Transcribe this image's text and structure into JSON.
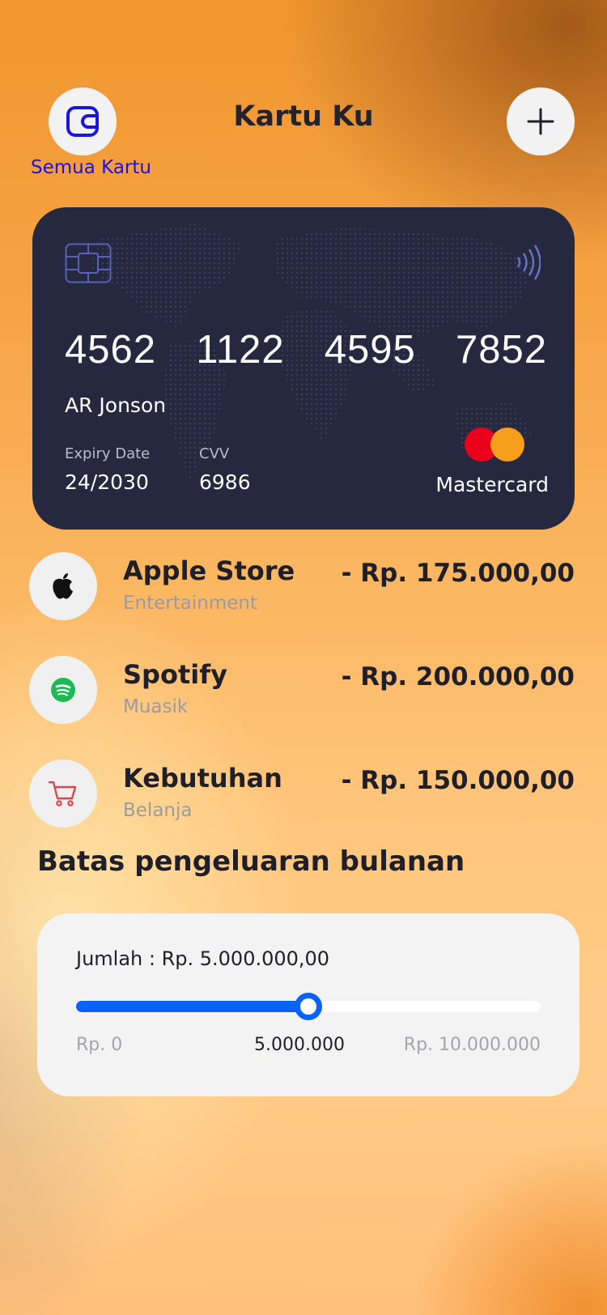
{
  "header": {
    "title": "Kartu Ku",
    "all_cards_label": "Semua Kartu",
    "wallet_icon": "wallet-icon",
    "add_icon": "plus-icon"
  },
  "card": {
    "number_groups": [
      "4562",
      "1122",
      "4595",
      "7852"
    ],
    "holder": "AR Jonson",
    "expiry_label": "Expiry Date",
    "expiry_value": "24/2030",
    "cvv_label": "CVV",
    "cvv_value": "6986",
    "brand": "Mastercard",
    "background_color": "#262840"
  },
  "transactions": [
    {
      "name": "Apple Store",
      "category": "Entertainment",
      "amount": "- Rp. 175.000,00",
      "icon": "apple-icon"
    },
    {
      "name": "Spotify",
      "category": "Muasik",
      "amount": "- Rp. 200.000,00",
      "icon": "spotify-icon"
    },
    {
      "name": "Kebutuhan",
      "category": "Belanja",
      "amount": "- Rp. 150.000,00",
      "icon": "cart-icon"
    }
  ],
  "spending_limit": {
    "title": "Batas pengeluaran bulanan",
    "amount_label": "Jumlah : Rp. 5.000.000,00",
    "min_label": "Rp. 0",
    "current_label": "5.000.000",
    "max_label": "Rp. 10.000.000",
    "min": 0,
    "max": 10000000,
    "value": 5000000,
    "accent_color": "#0a63f7"
  }
}
